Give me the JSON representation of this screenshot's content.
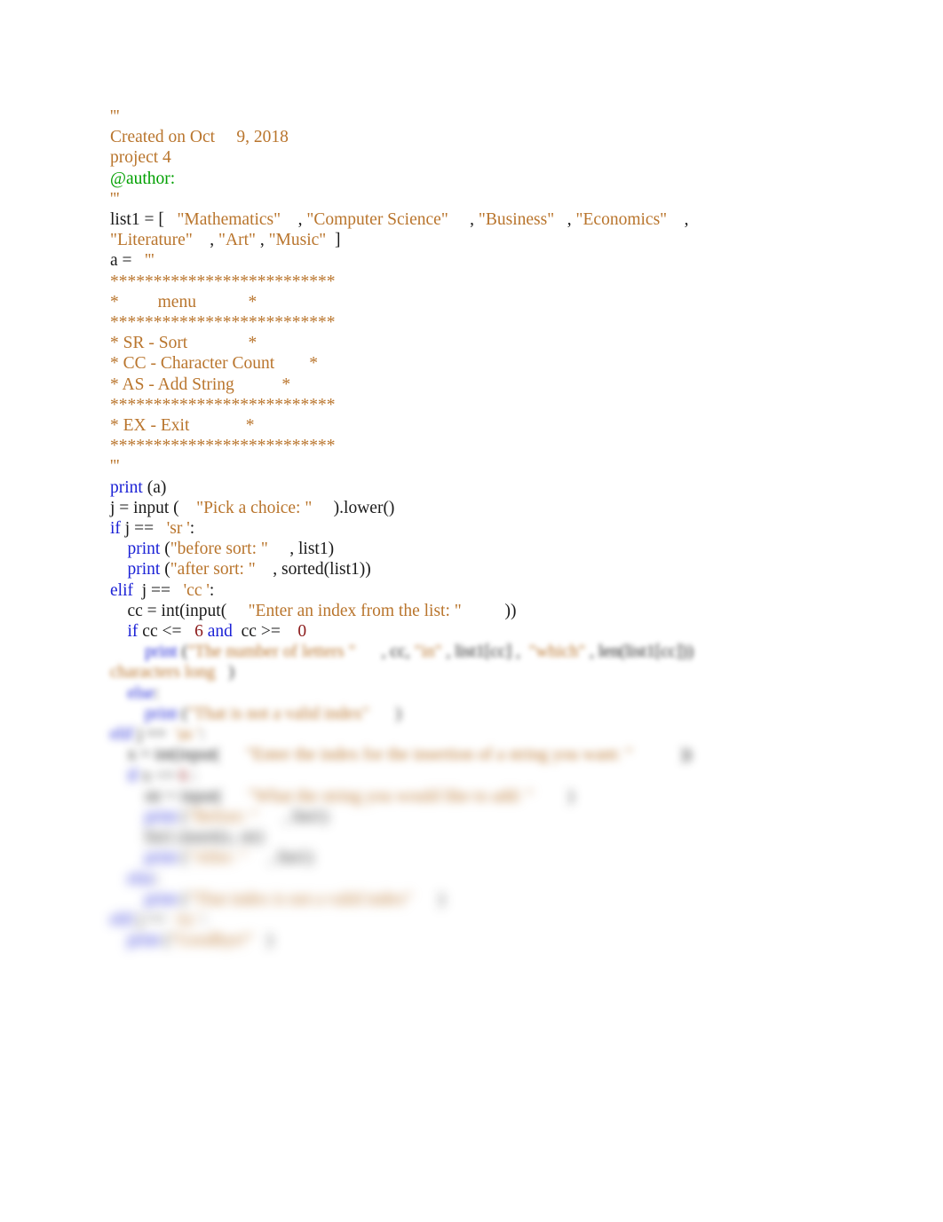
{
  "document": {
    "kind": "python-source-listing",
    "background_color": "#ffffff",
    "colors": {
      "string": "#b9752d",
      "keyword": "#1c22d6",
      "builtin": "#1c22d6",
      "number": "#8b1a1a",
      "decorator": "#00a000",
      "plain": "#1a1a1a"
    }
  },
  "code": {
    "lines": [
      {
        "id": "l01",
        "blur": 0,
        "tokens": [
          {
            "t": "'''",
            "c": "s"
          }
        ]
      },
      {
        "id": "l02",
        "blur": 0,
        "tokens": [
          {
            "t": "Created on Oct     9, 2018",
            "c": "s"
          }
        ]
      },
      {
        "id": "l03",
        "blur": 0,
        "tokens": [
          {
            "t": "project 4",
            "c": "s"
          }
        ]
      },
      {
        "id": "l04",
        "blur": 0,
        "tokens": [
          {
            "t": "@author:",
            "c": "dec"
          }
        ]
      },
      {
        "id": "l05",
        "blur": 0,
        "tokens": [
          {
            "t": "'''",
            "c": "s"
          }
        ]
      },
      {
        "id": "l06",
        "blur": 0,
        "tokens": [
          {
            "t": "",
            "c": "pl"
          }
        ]
      },
      {
        "id": "l07",
        "blur": 0,
        "tokens": [
          {
            "t": "list1 = [",
            "c": "pl"
          },
          {
            "t": "   \"Mathematics\"",
            "c": "s"
          },
          {
            "t": "    , ",
            "c": "pl"
          },
          {
            "t": "\"Computer Science\"",
            "c": "s"
          },
          {
            "t": "     , ",
            "c": "pl"
          },
          {
            "t": "\"Business\"",
            "c": "s"
          },
          {
            "t": "   , ",
            "c": "pl"
          },
          {
            "t": "\"Economics\"",
            "c": "s"
          },
          {
            "t": "    ,",
            "c": "pl"
          }
        ]
      },
      {
        "id": "l08",
        "blur": 0,
        "tokens": [
          {
            "t": "\"Literature\"",
            "c": "s"
          },
          {
            "t": "    , ",
            "c": "pl"
          },
          {
            "t": "\"Art\"",
            "c": "s"
          },
          {
            "t": " , ",
            "c": "pl"
          },
          {
            "t": "\"Music\"",
            "c": "s"
          },
          {
            "t": "  ]",
            "c": "pl"
          }
        ]
      },
      {
        "id": "l09",
        "blur": 0,
        "tokens": [
          {
            "t": "a = ",
            "c": "pl"
          },
          {
            "t": "  '''",
            "c": "s"
          }
        ]
      },
      {
        "id": "l10",
        "blur": 0,
        "tokens": [
          {
            "t": "**************************",
            "c": "s"
          }
        ]
      },
      {
        "id": "l11",
        "blur": 0,
        "tokens": [
          {
            "t": "*         menu            *",
            "c": "s"
          }
        ]
      },
      {
        "id": "l12",
        "blur": 0,
        "tokens": [
          {
            "t": "**************************",
            "c": "s"
          }
        ]
      },
      {
        "id": "l13",
        "blur": 0,
        "tokens": [
          {
            "t": "* SR - Sort              *",
            "c": "s"
          }
        ]
      },
      {
        "id": "l14",
        "blur": 0,
        "tokens": [
          {
            "t": "* CC - Character Count        *",
            "c": "s"
          }
        ]
      },
      {
        "id": "l15",
        "blur": 0,
        "tokens": [
          {
            "t": "* AS - Add String           *",
            "c": "s"
          }
        ]
      },
      {
        "id": "l16",
        "blur": 0,
        "tokens": [
          {
            "t": "**************************",
            "c": "s"
          }
        ]
      },
      {
        "id": "l17",
        "blur": 0,
        "tokens": [
          {
            "t": "* EX - Exit             *",
            "c": "s"
          }
        ]
      },
      {
        "id": "l18",
        "blur": 0,
        "tokens": [
          {
            "t": "**************************",
            "c": "s"
          }
        ]
      },
      {
        "id": "l19",
        "blur": 0,
        "tokens": [
          {
            "t": "'''",
            "c": "s"
          }
        ]
      },
      {
        "id": "l20",
        "blur": 0,
        "tokens": [
          {
            "t": "print",
            "c": "bi"
          },
          {
            "t": " (a)",
            "c": "pl"
          }
        ]
      },
      {
        "id": "l21",
        "blur": 0,
        "tokens": [
          {
            "t": "",
            "c": "pl"
          }
        ]
      },
      {
        "id": "l22",
        "blur": 0,
        "tokens": [
          {
            "t": "",
            "c": "pl"
          }
        ]
      },
      {
        "id": "l23",
        "blur": 0,
        "tokens": [
          {
            "t": "j = input (",
            "c": "pl"
          },
          {
            "t": "    \"Pick a choice: \"",
            "c": "s"
          },
          {
            "t": "     ).lower()",
            "c": "pl"
          }
        ]
      },
      {
        "id": "l24",
        "blur": 0,
        "tokens": [
          {
            "t": "",
            "c": "pl"
          }
        ]
      },
      {
        "id": "l25",
        "blur": 0,
        "tokens": [
          {
            "t": "if",
            "c": "kw"
          },
          {
            "t": " j == ",
            "c": "pl"
          },
          {
            "t": "  'sr '",
            "c": "s"
          },
          {
            "t": ":",
            "c": "pl"
          }
        ]
      },
      {
        "id": "l26",
        "blur": 0,
        "tokens": [
          {
            "t": "    ",
            "c": "pl"
          },
          {
            "t": "print",
            "c": "bi"
          },
          {
            "t": " (",
            "c": "pl"
          },
          {
            "t": "\"before sort: \"",
            "c": "s"
          },
          {
            "t": "     , list1)",
            "c": "pl"
          }
        ]
      },
      {
        "id": "l27",
        "blur": 0,
        "tokens": [
          {
            "t": "    ",
            "c": "pl"
          },
          {
            "t": "print",
            "c": "bi"
          },
          {
            "t": " (",
            "c": "pl"
          },
          {
            "t": "\"after sort: \"",
            "c": "s"
          },
          {
            "t": "    , sorted(list1))",
            "c": "pl"
          }
        ]
      },
      {
        "id": "l28",
        "blur": 0,
        "tokens": [
          {
            "t": "elif",
            "c": "kw"
          },
          {
            "t": "  j == ",
            "c": "pl"
          },
          {
            "t": "  'cc '",
            "c": "s"
          },
          {
            "t": ":",
            "c": "pl"
          }
        ]
      },
      {
        "id": "l29",
        "blur": 0,
        "tokens": [
          {
            "t": "    cc = int(input(",
            "c": "pl"
          },
          {
            "t": "     \"Enter an index from the list: \"",
            "c": "s"
          },
          {
            "t": "          ))",
            "c": "pl"
          }
        ]
      },
      {
        "id": "l30",
        "blur": 0,
        "tokens": [
          {
            "t": "    ",
            "c": "pl"
          },
          {
            "t": "if",
            "c": "kw"
          },
          {
            "t": " cc <= ",
            "c": "pl"
          },
          {
            "t": "  6",
            "c": "num"
          },
          {
            "t": " ",
            "c": "pl"
          },
          {
            "t": "and",
            "c": "kw"
          },
          {
            "t": "  cc >= ",
            "c": "pl"
          },
          {
            "t": "   0",
            "c": "num"
          }
        ]
      },
      {
        "id": "l31",
        "blur": 1,
        "tokens": [
          {
            "t": "        ",
            "c": "pl"
          },
          {
            "t": "print",
            "c": "bi"
          },
          {
            "t": " (",
            "c": "pl"
          },
          {
            "t": "\"The number of letters \"",
            "c": "s"
          },
          {
            "t": "      , cc, ",
            "c": "pl"
          },
          {
            "t": "\"in\"",
            "c": "s"
          },
          {
            "t": " , list1[cc] ,",
            "c": "pl"
          },
          {
            "t": "  \"which\"",
            "c": "s"
          },
          {
            "t": " , len(list1[cc]))",
            "c": "pl"
          }
        ]
      },
      {
        "id": "l32",
        "blur": 2,
        "tokens": [
          {
            "t": "characters long",
            "c": "s"
          },
          {
            "t": "   )",
            "c": "pl"
          }
        ]
      },
      {
        "id": "l33",
        "blur": 3,
        "tokens": [
          {
            "t": "    ",
            "c": "pl"
          },
          {
            "t": "else",
            "c": "kw"
          },
          {
            "t": ":",
            "c": "pl"
          }
        ]
      },
      {
        "id": "l34",
        "blur": 4,
        "tokens": [
          {
            "t": "        ",
            "c": "pl"
          },
          {
            "t": "print",
            "c": "bi"
          },
          {
            "t": " (",
            "c": "pl"
          },
          {
            "t": "\"That is not a valid index\"",
            "c": "s"
          },
          {
            "t": "      )",
            "c": "pl"
          }
        ]
      },
      {
        "id": "l35",
        "blur": 5,
        "tokens": [
          {
            "t": "elif",
            "c": "kw"
          },
          {
            "t": " j == ",
            "c": "pl"
          },
          {
            "t": " 'as '",
            "c": "s"
          },
          {
            "t": ":",
            "c": "pl"
          }
        ]
      },
      {
        "id": "l36",
        "blur": 6,
        "tokens": [
          {
            "t": "    x = int(input(",
            "c": "pl"
          },
          {
            "t": "      \"Enter the index for the insertion of a string you want: \"",
            "c": "s"
          },
          {
            "t": "           ))",
            "c": "pl"
          }
        ]
      },
      {
        "id": "l37",
        "blur": 7,
        "tokens": [
          {
            "t": "    ",
            "c": "pl"
          },
          {
            "t": "if",
            "c": "kw"
          },
          {
            "t": " x <= ",
            "c": "pl"
          },
          {
            "t": "6",
            "c": "num"
          },
          {
            "t": " :",
            "c": "pl"
          }
        ]
      },
      {
        "id": "l38",
        "blur": 8,
        "tokens": [
          {
            "t": "        str = input(",
            "c": "pl"
          },
          {
            "t": "      \"What the string you would like to add: \"",
            "c": "s"
          },
          {
            "t": "        )",
            "c": "pl"
          }
        ]
      },
      {
        "id": "l39",
        "blur": 9,
        "tokens": [
          {
            "t": "        ",
            "c": "pl"
          },
          {
            "t": "print",
            "c": "bi"
          },
          {
            "t": " (",
            "c": "pl"
          },
          {
            "t": "\"Before: \"",
            "c": "s"
          },
          {
            "t": "      , list1)",
            "c": "pl"
          }
        ]
      },
      {
        "id": "l40",
        "blur": 10,
        "tokens": [
          {
            "t": "        list1.insert(x, str)",
            "c": "pl"
          }
        ]
      },
      {
        "id": "l41",
        "blur": 10,
        "tokens": [
          {
            "t": "        ",
            "c": "pl"
          },
          {
            "t": "print",
            "c": "bi"
          },
          {
            "t": " (",
            "c": "pl"
          },
          {
            "t": "\"After: \"",
            "c": "s"
          },
          {
            "t": "     , list1)",
            "c": "pl"
          }
        ]
      },
      {
        "id": "l42",
        "blur": 10,
        "tokens": [
          {
            "t": "    ",
            "c": "pl"
          },
          {
            "t": "else",
            "c": "kw"
          },
          {
            "t": ":",
            "c": "pl"
          }
        ]
      },
      {
        "id": "l43",
        "blur": 10,
        "tokens": [
          {
            "t": "        ",
            "c": "pl"
          },
          {
            "t": "print",
            "c": "bi"
          },
          {
            "t": " (",
            "c": "pl"
          },
          {
            "t": "\"That index is not a valid index\"",
            "c": "s"
          },
          {
            "t": "      )",
            "c": "pl"
          }
        ]
      },
      {
        "id": "l44",
        "blur": 10,
        "tokens": [
          {
            "t": "elif",
            "c": "kw"
          },
          {
            "t": " j == ",
            "c": "pl"
          },
          {
            "t": " 'ex '",
            "c": "s"
          },
          {
            "t": ":",
            "c": "pl"
          }
        ]
      },
      {
        "id": "l45",
        "blur": 10,
        "tokens": [
          {
            "t": "",
            "c": "pl"
          }
        ]
      },
      {
        "id": "l46",
        "blur": 10,
        "tokens": [
          {
            "t": "    ",
            "c": "pl"
          },
          {
            "t": "print",
            "c": "bi"
          },
          {
            "t": " (",
            "c": "pl"
          },
          {
            "t": "\"Goodbye!\"",
            "c": "s"
          },
          {
            "t": "   )",
            "c": "pl"
          }
        ]
      }
    ]
  }
}
